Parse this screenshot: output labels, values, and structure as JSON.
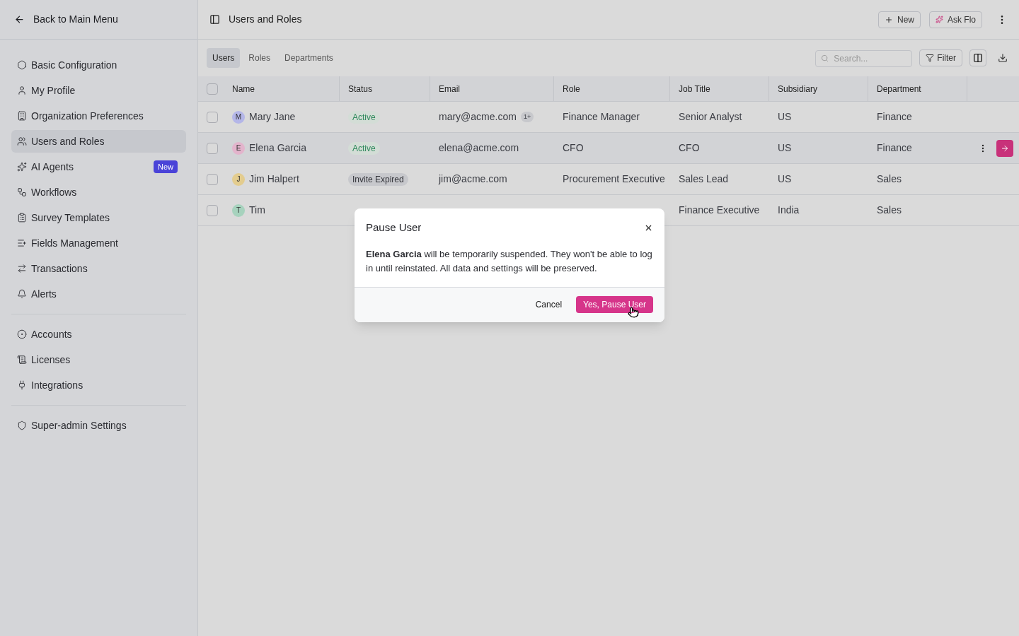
{
  "sidebar": {
    "back_label": "Back to Main Menu",
    "groups": [
      {
        "items": [
          {
            "label": "Basic Configuration",
            "selected": false
          },
          {
            "label": "My Profile",
            "selected": false
          },
          {
            "label": "Organization Preferences",
            "selected": false
          },
          {
            "label": "Users and Roles",
            "selected": true
          },
          {
            "label": "AI Agents",
            "selected": false,
            "badge": "New"
          },
          {
            "label": "Workflows",
            "selected": false
          },
          {
            "label": "Survey Templates",
            "selected": false
          },
          {
            "label": "Fields Management",
            "selected": false
          },
          {
            "label": "Transactions",
            "selected": false
          },
          {
            "label": "Alerts",
            "selected": false
          }
        ]
      },
      {
        "items": [
          {
            "label": "Accounts",
            "selected": false
          },
          {
            "label": "Licenses",
            "selected": false
          },
          {
            "label": "Integrations",
            "selected": false
          }
        ]
      },
      {
        "items": [
          {
            "label": "Super-admin Settings",
            "selected": false
          }
        ]
      }
    ]
  },
  "header": {
    "title": "Users and Roles",
    "buttons": [
      {
        "label": "New",
        "kind": "new"
      },
      {
        "label": "Ask Flo",
        "kind": "ai"
      }
    ]
  },
  "tabs": [
    {
      "label": "Users",
      "selected": true
    },
    {
      "label": "Roles",
      "selected": false
    },
    {
      "label": "Departments",
      "selected": false
    }
  ],
  "toolbar": {
    "search": {
      "placeholder": "Search..."
    },
    "filter_label": "Filter"
  },
  "table": {
    "select_all_checked": false,
    "columns": [
      "Name",
      "Status",
      "Email",
      "Role",
      "Job Title",
      "Subsidiary",
      "Department"
    ],
    "rows": [
      {
        "initial": "M",
        "name": "Mary Jane",
        "color": "#b4b6e8",
        "status": {
          "label": "Active",
          "kind": "active"
        },
        "email": "mary@acme.com",
        "email_extra": "1+",
        "role": "Finance Manager",
        "job_title": "Senior Analyst",
        "subsidiary": "US",
        "department": "Finance",
        "selected": false,
        "checked": false
      },
      {
        "initial": "E",
        "name": "Elena Garcia",
        "color": "#e3b4cc",
        "status": {
          "label": "Active",
          "kind": "active"
        },
        "email": "elena@acme.com",
        "role": "CFO",
        "job_title": "CFO",
        "subsidiary": "US",
        "department": "Finance",
        "selected": true,
        "checked": false
      },
      {
        "initial": "J",
        "name": "Jim Halpert",
        "color": "#e3cc8e",
        "status": {
          "label": "Invite Expired",
          "kind": "expired"
        },
        "email": "jim@acme.com",
        "role": "Procurement Executive",
        "job_title": "Sales Lead",
        "subsidiary": "US",
        "department": "Sales",
        "selected": false,
        "checked": false
      },
      {
        "initial": "T",
        "name": "Tim",
        "color": "#a6d2bd",
        "job_title": "Finance Executive",
        "subsidiary": "India",
        "department": "Sales",
        "selected": false,
        "checked": false
      }
    ]
  },
  "dialog": {
    "title": "Pause User",
    "message": "**Elena Garcia** will be temporarily suspended. They won't be able to log in until reinstated. All data and settings will be preserved.",
    "cancel_label": "Cancel",
    "confirm_label": "Yes, Pause User"
  }
}
